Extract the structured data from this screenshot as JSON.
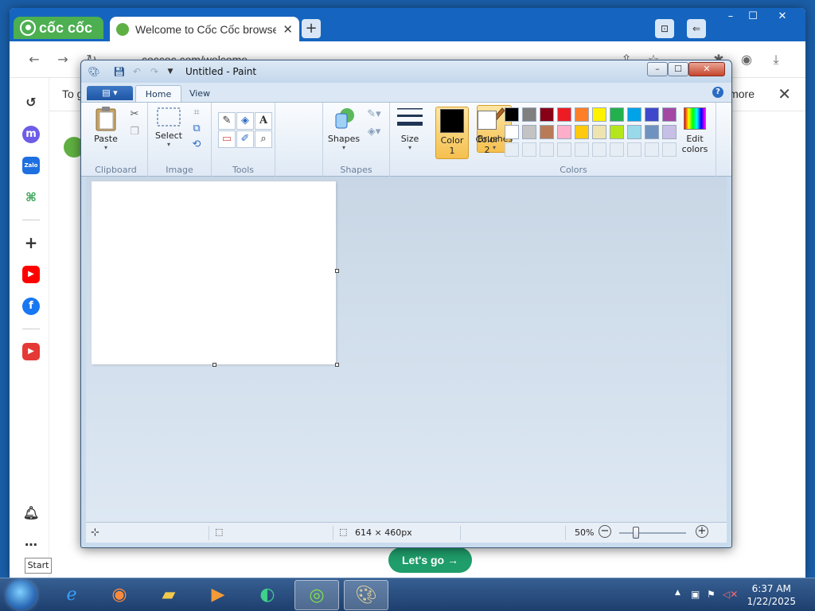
{
  "browser": {
    "logo_text": "cốc cốc",
    "tab_title": "Welcome to Cốc Cốc browser",
    "new_tab": "+",
    "url": "coccoc.com/welcome",
    "infobar_left": "To g",
    "infobar_more": "more",
    "close_glyph": "✕",
    "lets_go": "Let's go →",
    "window_controls": [
      "–",
      "☐",
      "✕"
    ]
  },
  "tooltip": {
    "text": "Start"
  },
  "paint": {
    "title": "Untitled - Paint",
    "window_controls": [
      "–",
      "☐",
      "✕"
    ],
    "tabs": {
      "home": "Home",
      "view": "View"
    },
    "help": "?",
    "groups": {
      "clipboard": "Clipboard",
      "image": "Image",
      "tools": "Tools",
      "shapes": "Shapes",
      "colors": "Colors"
    },
    "buttons": {
      "paste": "Paste",
      "select": "Select",
      "brushes": "Brushes",
      "shapes": "Shapes",
      "size": "Size",
      "color1_line1": "Color",
      "color1_line2": "1",
      "color2_line1": "Color",
      "color2_line2": "2",
      "edit_colors_line1": "Edit",
      "edit_colors_line2": "colors"
    },
    "palette_row1": [
      "#000000",
      "#7f7f7f",
      "#880015",
      "#ed1c24",
      "#ff7f27",
      "#fff200",
      "#22b14c",
      "#00a2e8",
      "#3f48cc",
      "#a349a4"
    ],
    "palette_row2": [
      "#ffffff",
      "#c3c3c3",
      "#b97a57",
      "#ffaec9",
      "#ffc90e",
      "#efe4b0",
      "#b5e61d",
      "#99d9ea",
      "#7092be",
      "#c8bfe7"
    ],
    "color1": "#000000",
    "color2": "#ffffff",
    "status": {
      "size": "614 × 460px",
      "zoom": "50%",
      "zoom_level": 0.5
    }
  },
  "taskbar": {
    "time": "6:37 AM",
    "date": "1/22/2025"
  }
}
